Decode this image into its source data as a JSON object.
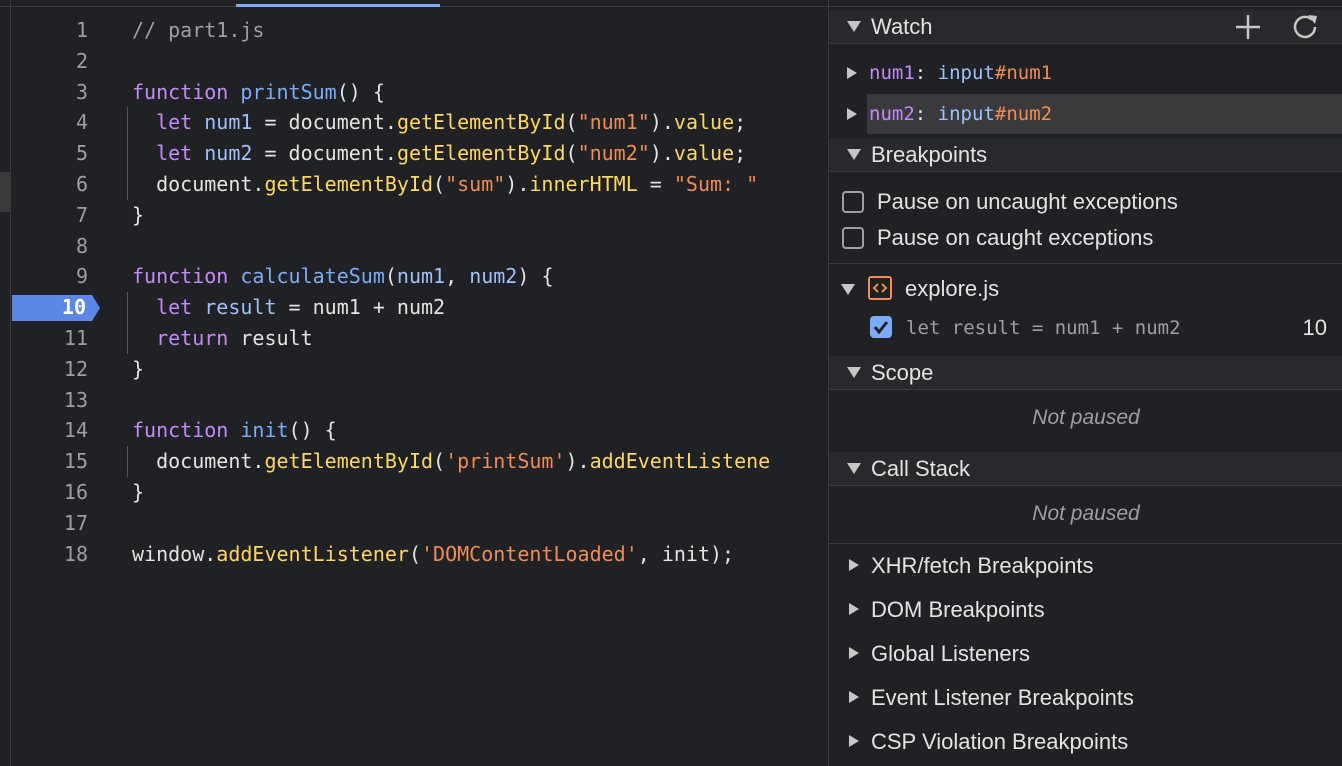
{
  "editor": {
    "lines": [
      {
        "num": "1",
        "tokens": [
          [
            "comment",
            "// part1.js"
          ]
        ]
      },
      {
        "num": "2",
        "tokens": []
      },
      {
        "num": "3",
        "tokens": [
          [
            "keyword",
            "function"
          ],
          [
            "plain",
            " "
          ],
          [
            "func",
            "printSum"
          ],
          [
            "plain",
            "() {"
          ]
        ]
      },
      {
        "num": "4",
        "guide": true,
        "tokens": [
          [
            "plain",
            "  "
          ],
          [
            "keyword",
            "let"
          ],
          [
            "plain",
            " "
          ],
          [
            "var",
            "num1"
          ],
          [
            "plain",
            " = document."
          ],
          [
            "method",
            "getElementById"
          ],
          [
            "plain",
            "("
          ],
          [
            "string",
            "\"num1\""
          ],
          [
            "plain",
            ")."
          ],
          [
            "method",
            "value"
          ],
          [
            "plain",
            ";"
          ]
        ]
      },
      {
        "num": "5",
        "guide": true,
        "tokens": [
          [
            "plain",
            "  "
          ],
          [
            "keyword",
            "let"
          ],
          [
            "plain",
            " "
          ],
          [
            "var",
            "num2"
          ],
          [
            "plain",
            " = document."
          ],
          [
            "method",
            "getElementById"
          ],
          [
            "plain",
            "("
          ],
          [
            "string",
            "\"num2\""
          ],
          [
            "plain",
            ")."
          ],
          [
            "method",
            "value"
          ],
          [
            "plain",
            ";"
          ]
        ]
      },
      {
        "num": "6",
        "guide": true,
        "tokens": [
          [
            "plain",
            "  document."
          ],
          [
            "method",
            "getElementById"
          ],
          [
            "plain",
            "("
          ],
          [
            "string",
            "\"sum\""
          ],
          [
            "plain",
            ")."
          ],
          [
            "method",
            "innerHTML"
          ],
          [
            "plain",
            " = "
          ],
          [
            "string",
            "\"Sum: \""
          ]
        ]
      },
      {
        "num": "7",
        "tokens": [
          [
            "plain",
            "}"
          ]
        ]
      },
      {
        "num": "8",
        "tokens": []
      },
      {
        "num": "9",
        "tokens": [
          [
            "keyword",
            "function"
          ],
          [
            "plain",
            " "
          ],
          [
            "func",
            "calculateSum"
          ],
          [
            "plain",
            "("
          ],
          [
            "var",
            "num1"
          ],
          [
            "plain",
            ", "
          ],
          [
            "var",
            "num2"
          ],
          [
            "plain",
            ") {"
          ]
        ]
      },
      {
        "num": "10",
        "guide": true,
        "breakpoint": true,
        "tokens": [
          [
            "plain",
            "  "
          ],
          [
            "keyword",
            "let"
          ],
          [
            "plain",
            " "
          ],
          [
            "var",
            "result"
          ],
          [
            "plain",
            " = num1 + num2"
          ]
        ]
      },
      {
        "num": "11",
        "guide": true,
        "tokens": [
          [
            "plain",
            "  "
          ],
          [
            "keyword",
            "return"
          ],
          [
            "plain",
            " result"
          ]
        ]
      },
      {
        "num": "12",
        "tokens": [
          [
            "plain",
            "}"
          ]
        ]
      },
      {
        "num": "13",
        "tokens": []
      },
      {
        "num": "14",
        "tokens": [
          [
            "keyword",
            "function"
          ],
          [
            "plain",
            " "
          ],
          [
            "func",
            "init"
          ],
          [
            "plain",
            "() {"
          ]
        ]
      },
      {
        "num": "15",
        "guide": true,
        "tokens": [
          [
            "plain",
            "  document."
          ],
          [
            "method",
            "getElementById"
          ],
          [
            "plain",
            "("
          ],
          [
            "string",
            "'printSum'"
          ],
          [
            "plain",
            ")."
          ],
          [
            "method",
            "addEventListene"
          ]
        ]
      },
      {
        "num": "16",
        "tokens": [
          [
            "plain",
            "}"
          ]
        ]
      },
      {
        "num": "17",
        "tokens": []
      },
      {
        "num": "18",
        "tokens": [
          [
            "plain",
            "window."
          ],
          [
            "method",
            "addEventListener"
          ],
          [
            "plain",
            "("
          ],
          [
            "string",
            "'DOMContentLoaded'"
          ],
          [
            "plain",
            ", init);"
          ]
        ]
      }
    ]
  },
  "sidebar": {
    "watch": {
      "title": "Watch",
      "add_icon": "plus-icon",
      "refresh_icon": "refresh-icon",
      "items": [
        {
          "name": "num1",
          "colon": ":",
          "value": "input",
          "id": "#num1"
        },
        {
          "name": "num2",
          "colon": ":",
          "value": "input",
          "id": "#num2"
        }
      ]
    },
    "breakpoints": {
      "title": "Breakpoints",
      "pause_uncaught": "Pause on uncaught exceptions",
      "pause_caught": "Pause on caught exceptions",
      "file": "explore.js",
      "entry_code": "let result = num1 + num2",
      "entry_line": "10"
    },
    "scope": {
      "title": "Scope",
      "status": "Not paused"
    },
    "call_stack": {
      "title": "Call Stack",
      "status": "Not paused"
    },
    "collapsed": [
      {
        "title": "XHR/fetch Breakpoints"
      },
      {
        "title": "DOM Breakpoints"
      },
      {
        "title": "Global Listeners"
      },
      {
        "title": "Event Listener Breakpoints"
      },
      {
        "title": "CSP Violation Breakpoints"
      }
    ]
  },
  "colors": {
    "background": "#202124",
    "breakpoint": "#5b87e6",
    "keyword": "#c58af9",
    "method": "#fdd663",
    "string": "#f28b54",
    "variable": "#9ec1fb"
  }
}
